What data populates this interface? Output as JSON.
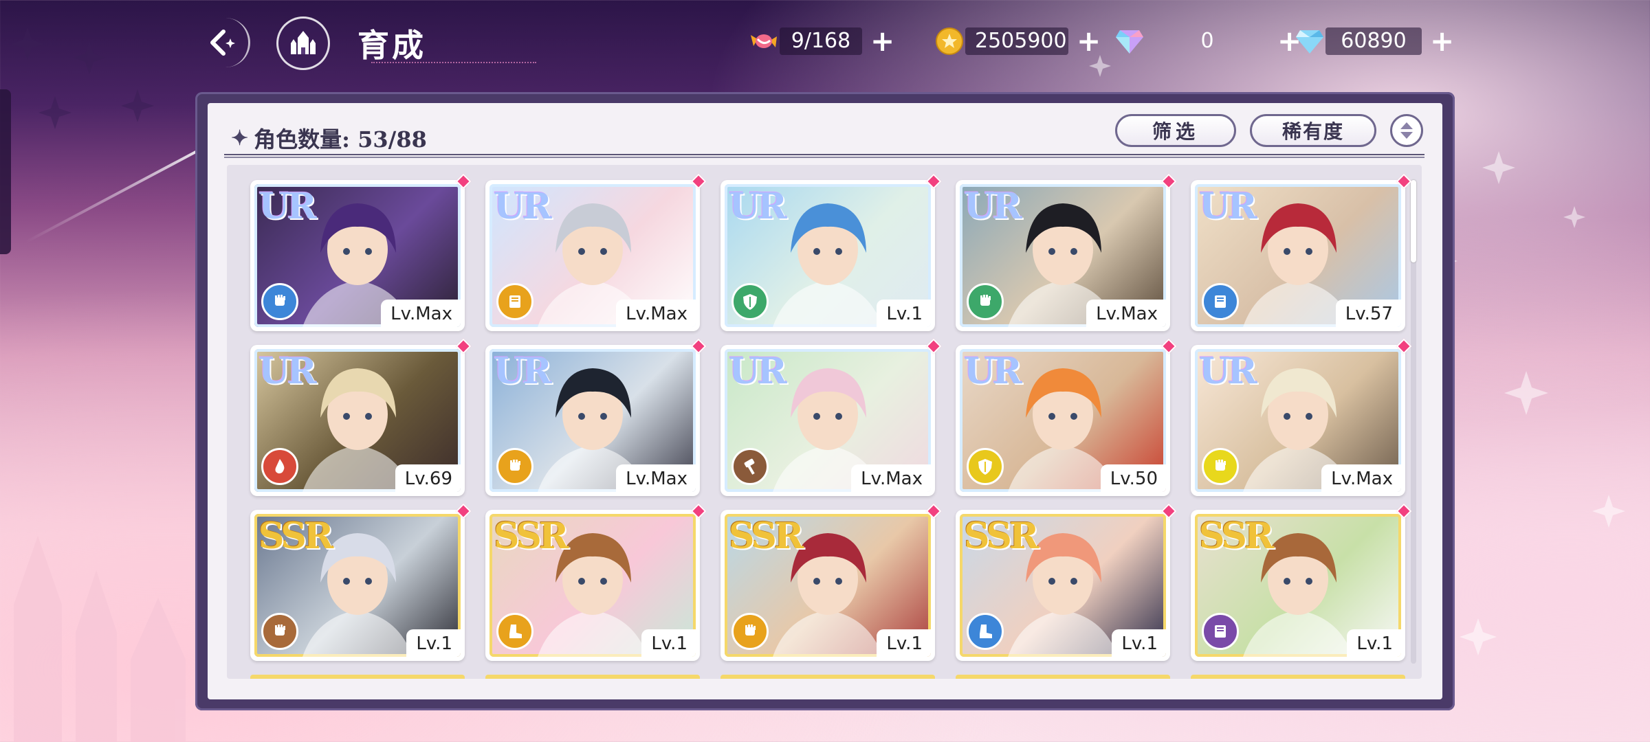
{
  "header": {
    "title": "育成"
  },
  "resources": [
    {
      "name": "candy",
      "value": "9/168"
    },
    {
      "name": "gold-coin",
      "value": "2505900"
    },
    {
      "name": "rainbow-diamond",
      "value": "0"
    },
    {
      "name": "diamond",
      "value": "60890"
    }
  ],
  "panel": {
    "count_label": "角色数量: 53/88",
    "filter_label": "筛选",
    "rarity_label": "稀有度"
  },
  "colors": {
    "accent_pink": "#f2407f",
    "panel_frame": "#4a3a68",
    "ur_frame": "#d6ecff",
    "ssr_frame": "#f5d86a"
  },
  "cards": [
    {
      "rarity": "UR",
      "level": "Lv.Max",
      "element": "fist",
      "element_color": "#3d86d8",
      "art": [
        "#3a2a52",
        "#6a4a9a",
        "#2a2030"
      ],
      "hair": "#4a2a7a"
    },
    {
      "rarity": "UR",
      "level": "Lv.Max",
      "element": "book",
      "element_color": "#e8a21c",
      "art": [
        "#cfe6ff",
        "#f6d8e0",
        "#ffffff"
      ],
      "hair": "#c8ccd6"
    },
    {
      "rarity": "UR",
      "level": "Lv.1",
      "element": "shield",
      "element_color": "#3da86a",
      "art": [
        "#a8d8f0",
        "#e0f0e8",
        "#dfeaf2"
      ],
      "hair": "#4a90d8"
    },
    {
      "rarity": "UR",
      "level": "Lv.Max",
      "element": "fist",
      "element_color": "#3da86a",
      "art": [
        "#8aa8b8",
        "#d8c8b0",
        "#5a4a3a"
      ],
      "hair": "#1e1e24"
    },
    {
      "rarity": "UR",
      "level": "Lv.57",
      "element": "book",
      "element_color": "#3d86d8",
      "art": [
        "#f0e0c8",
        "#d8c0a8",
        "#a8c8e8"
      ],
      "hair": "#b82a3a"
    },
    {
      "rarity": "UR",
      "level": "Lv.69",
      "element": "drop",
      "element_color": "#d84a3a",
      "art": [
        "#d8c8a0",
        "#6a5a3a",
        "#3a2a2a"
      ],
      "hair": "#e8d8b0"
    },
    {
      "rarity": "UR",
      "level": "Lv.Max",
      "element": "fist",
      "element_color": "#e8a21c",
      "art": [
        "#8ab0d8",
        "#d8e0e8",
        "#3a3a48"
      ],
      "hair": "#1e2430"
    },
    {
      "rarity": "UR",
      "level": "Lv.Max",
      "element": "hammer",
      "element_color": "#8a5a3a",
      "art": [
        "#c8e8c8",
        "#e8f0e0",
        "#f0d8e0"
      ],
      "hair": "#f0c8d8"
    },
    {
      "rarity": "UR",
      "level": "Lv.50",
      "element": "shield",
      "element_color": "#e8c81c",
      "art": [
        "#e8d8c8",
        "#d8b898",
        "#c83a2a"
      ],
      "hair": "#f08a3a"
    },
    {
      "rarity": "UR",
      "level": "Lv.Max",
      "element": "fist",
      "element_color": "#e8d81c",
      "art": [
        "#f8e8d8",
        "#d8c0a0",
        "#6a5a4a"
      ],
      "hair": "#f0e8d0"
    },
    {
      "rarity": "SSR",
      "level": "Lv.1",
      "element": "fist",
      "element_color": "#a86a3a",
      "art": [
        "#6a7890",
        "#c8d0d8",
        "#2a2a32"
      ],
      "hair": "#d8dce8"
    },
    {
      "rarity": "SSR",
      "level": "Lv.1",
      "element": "boot",
      "element_color": "#e8a21c",
      "art": [
        "#e8d8c0",
        "#f8c8d8",
        "#c8e8d8"
      ],
      "hair": "#a86a3a"
    },
    {
      "rarity": "SSR",
      "level": "Lv.1",
      "element": "fist",
      "element_color": "#e8a21c",
      "art": [
        "#b8d8e8",
        "#e8c8a8",
        "#a83a3a"
      ],
      "hair": "#a82a3a"
    },
    {
      "rarity": "SSR",
      "level": "Lv.1",
      "element": "boot",
      "element_color": "#3d86d8",
      "art": [
        "#c8d8e8",
        "#f0d0c0",
        "#2a2a48"
      ],
      "hair": "#f0987a"
    },
    {
      "rarity": "SSR",
      "level": "Lv.1",
      "element": "book",
      "element_color": "#7a4aa8",
      "art": [
        "#e8e0d0",
        "#c8e0a8",
        "#f8f8f8"
      ],
      "hair": "#a8683a"
    }
  ]
}
